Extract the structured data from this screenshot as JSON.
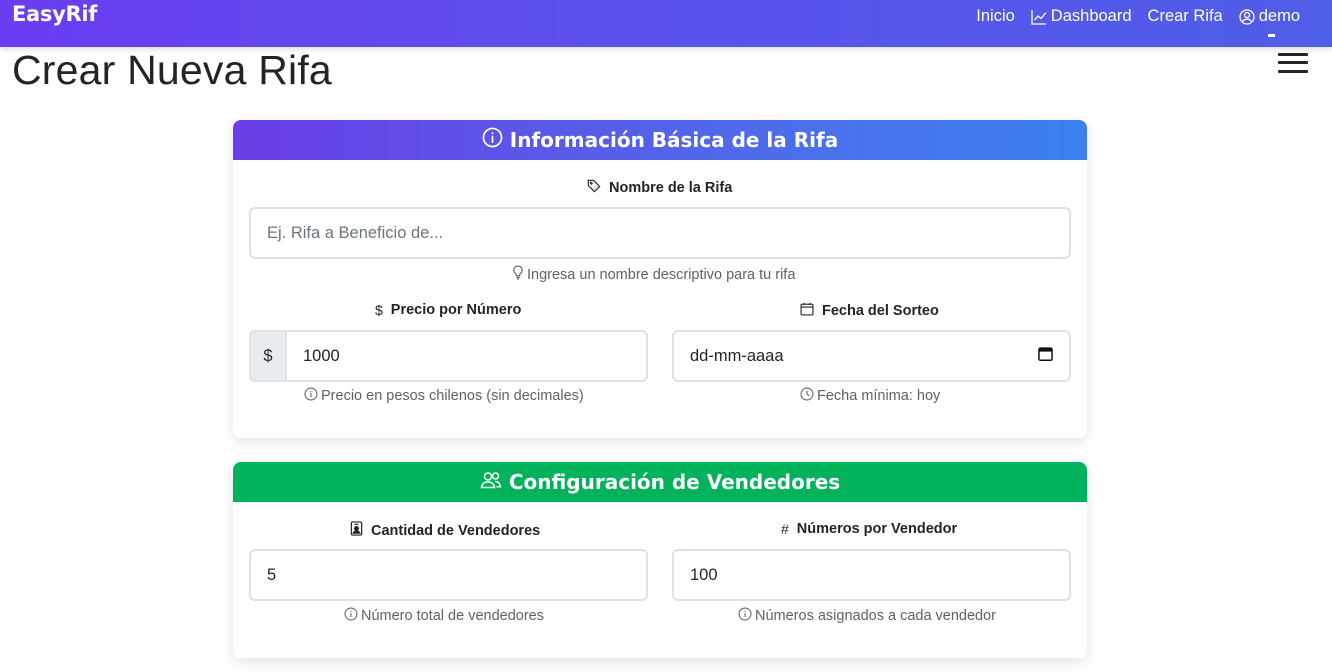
{
  "navbar": {
    "brand": "EasyRif",
    "links": {
      "inicio": "Inicio",
      "dashboard": "Dashboard",
      "crear_rifa": "Crear Rifa",
      "user": "demo"
    }
  },
  "page": {
    "title": "Crear Nueva Rifa"
  },
  "basic_info": {
    "header": "Información Básica de la Rifa",
    "name_label": "Nombre de la Rifa",
    "name_placeholder": "Ej. Rifa a Beneficio de...",
    "name_help": "Ingresa un nombre descriptivo para tu rifa",
    "price_label": "Precio por Número",
    "price_prefix": "$",
    "price_value": "1000",
    "price_help": "Precio en pesos chilenos (sin decimales)",
    "date_label": "Fecha del Sorteo",
    "date_value": "dd-mm-aaaa",
    "date_help": "Fecha mínima: hoy"
  },
  "vendors": {
    "header": "Configuración de Vendedores",
    "count_label": "Cantidad de Vendedores",
    "count_value": "5",
    "count_help": "Número total de vendedores",
    "numbers_label": "Números por Vendedor",
    "numbers_prefix": "#",
    "numbers_value": "100",
    "numbers_help": "Números asignados a cada vendedor"
  },
  "icons": {
    "dashboard": "chart-line-icon",
    "user": "person-circle-icon",
    "info": "info-circle-icon",
    "tag": "tag-icon",
    "bulb": "lightbulb-icon",
    "calendar": "calendar-icon",
    "clock": "clock-icon",
    "people": "people-icon",
    "badge": "person-badge-icon",
    "menu": "hamburger-icon"
  },
  "colors": {
    "navbar": "#5b50ec",
    "card_1_header": "#4f6aea",
    "card_2_header": "#00b35a"
  }
}
